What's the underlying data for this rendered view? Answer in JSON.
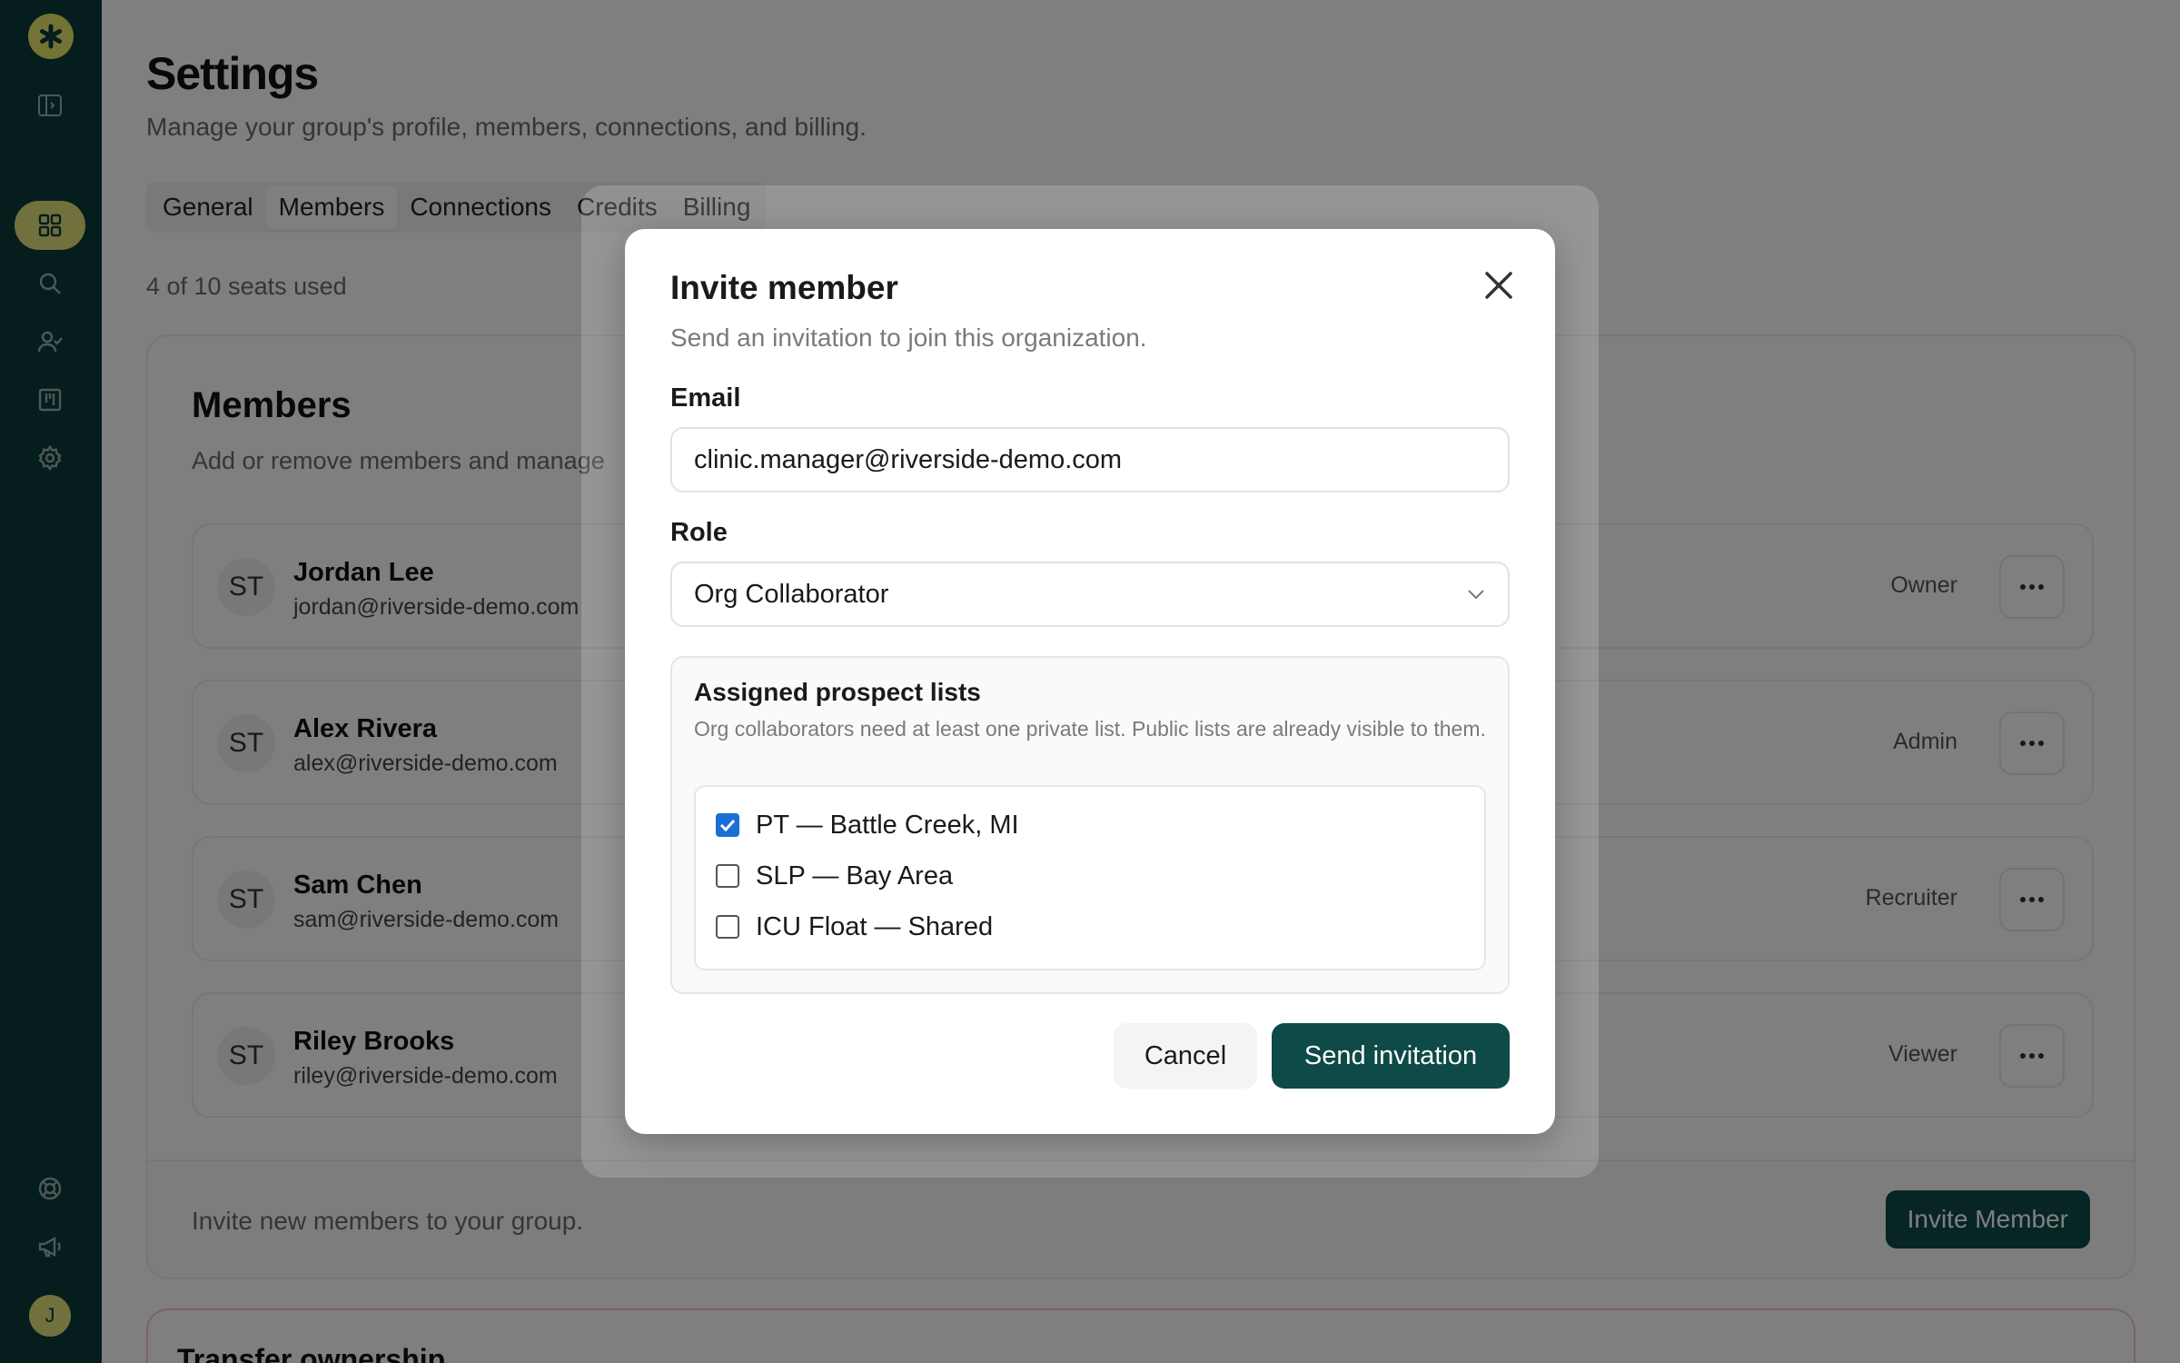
{
  "sidebar": {
    "logo_icon": "asterisk-logo-icon",
    "top_items": [
      {
        "name": "sidebar-toggle",
        "icon": "panel-toggle-icon"
      }
    ],
    "nav_items": [
      {
        "name": "dashboard",
        "icon": "grid-icon",
        "active": true
      },
      {
        "name": "search",
        "icon": "search-icon",
        "active": false
      },
      {
        "name": "candidates",
        "icon": "user-check-icon",
        "active": false
      },
      {
        "name": "board",
        "icon": "kanban-icon",
        "active": false
      },
      {
        "name": "settings",
        "icon": "gear-icon",
        "active": false
      }
    ],
    "bottom_items": [
      {
        "name": "help",
        "icon": "lifebuoy-icon"
      },
      {
        "name": "announcements",
        "icon": "megaphone-icon"
      }
    ],
    "avatar_initial": "J"
  },
  "page": {
    "title": "Settings",
    "subtitle": "Manage your group's profile, members, connections, and billing.",
    "tabs": [
      "General",
      "Members",
      "Connections",
      "Credits",
      "Billing"
    ],
    "active_tab": "Members",
    "seats": "4 of 10 seats used"
  },
  "members_card": {
    "title": "Members",
    "subtitle": "Add or remove members and manage",
    "members": [
      {
        "initials": "ST",
        "name": "Jordan Lee",
        "email": "jordan@riverside-demo.com",
        "role": "Owner"
      },
      {
        "initials": "ST",
        "name": "Alex Rivera",
        "email": "alex@riverside-demo.com",
        "role": "Admin"
      },
      {
        "initials": "ST",
        "name": "Sam Chen",
        "email": "sam@riverside-demo.com",
        "role": "Recruiter"
      },
      {
        "initials": "ST",
        "name": "Riley Brooks",
        "email": "riley@riverside-demo.com",
        "role": "Viewer"
      }
    ],
    "footer_text": "Invite new members to your group.",
    "invite_button": "Invite Member"
  },
  "transfer_card": {
    "title": "Transfer ownership"
  },
  "dialog": {
    "title": "Invite member",
    "subtitle": "Send an invitation to join this organization.",
    "email_label": "Email",
    "email_value": "clinic.manager@riverside-demo.com",
    "role_label": "Role",
    "role_value": "Org Collaborator",
    "lists_title": "Assigned prospect lists",
    "lists_description": "Org collaborators need at least one private list. Public lists are already visible to them.",
    "lists": [
      {
        "label": "PT — Battle Creek, MI",
        "checked": true
      },
      {
        "label": "SLP — Bay Area",
        "checked": false
      },
      {
        "label": "ICU Float — Shared",
        "checked": false
      }
    ],
    "cancel_label": "Cancel",
    "send_label": "Send invitation"
  },
  "colors": {
    "sidebar_bg": "#0d3b3a",
    "accent_yellow": "#e2e37a",
    "primary_button": "#0d4a48",
    "checkbox_checked": "#1a6fd6"
  }
}
